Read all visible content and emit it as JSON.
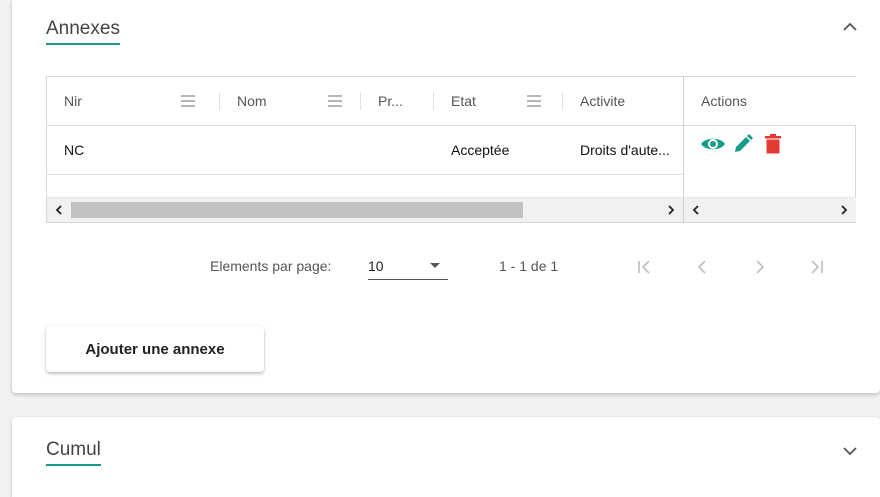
{
  "annexes": {
    "title": "Annexes",
    "table": {
      "columns": [
        "Nir",
        "Nom",
        "Pr...",
        "Etat",
        "Activite"
      ],
      "actions_header": "Actions",
      "rows": [
        {
          "nir": "NC",
          "nom": "",
          "pr": "",
          "etat": "Acceptée",
          "activite": "Droits d'aute..."
        }
      ]
    },
    "paginator": {
      "label": "Elements par page:",
      "page_size": "10",
      "range": "1 - 1 de 1"
    },
    "add_button": "Ajouter une annexe"
  },
  "cumul": {
    "title": "Cumul"
  },
  "colors": {
    "accent": "#1a9c8a",
    "delete": "#e53935"
  },
  "icons": [
    "chevron-up-icon",
    "column-menu-icon",
    "eye-icon",
    "pencil-icon",
    "trash-icon",
    "first-page-icon",
    "prev-page-icon",
    "next-page-icon",
    "last-page-icon",
    "chevron-down-icon"
  ]
}
